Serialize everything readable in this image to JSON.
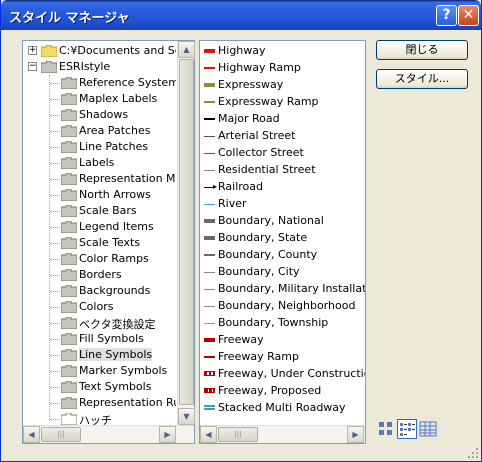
{
  "window": {
    "title": "スタイル マネージャ"
  },
  "titlebar_buttons": {
    "help": "?",
    "close": "✕"
  },
  "buttons": {
    "close_label": "閉じる",
    "styles_label": "スタイル..."
  },
  "tree": {
    "root1": "C:¥Documents and Setti",
    "root2": "ESRIstyle",
    "items": [
      "Reference Systems",
      "Maplex Labels",
      "Shadows",
      "Area Patches",
      "Line Patches",
      "Labels",
      "Representation Mark",
      "North Arrows",
      "Scale Bars",
      "Legend Items",
      "Scale Texts",
      "Color Ramps",
      "Borders",
      "Backgrounds",
      "Colors",
      "ベクタ変換設定",
      "Fill Symbols",
      "Line Symbols",
      "Marker Symbols",
      "Text Symbols",
      "Representation Rules",
      "ハッチ"
    ],
    "selected_index": 17
  },
  "symbols": [
    {
      "label": "Highway",
      "color": "#e01010",
      "style": "thick"
    },
    {
      "label": "Highway Ramp",
      "color": "#e01010",
      "style": "medium"
    },
    {
      "label": "Expressway",
      "color": "#8c8c3c",
      "style": "thick"
    },
    {
      "label": "Expressway Ramp",
      "color": "#8c8c3c",
      "style": "medium"
    },
    {
      "label": "Major Road",
      "color": "#000000",
      "style": "medium"
    },
    {
      "label": "Arterial Street",
      "color": "#555555",
      "style": "thin"
    },
    {
      "label": "Collector Street",
      "color": "#555555",
      "style": "thin"
    },
    {
      "label": "Residential Street",
      "color": "#888888",
      "style": "thin"
    },
    {
      "label": "Railroad",
      "color": "#000000",
      "style": "arrow"
    },
    {
      "label": "River",
      "color": "#4aa3e8",
      "style": "thin"
    },
    {
      "label": "Boundary, National",
      "color": "#6a6a6a",
      "style": "thick"
    },
    {
      "label": "Boundary, State",
      "color": "#6a6a6a",
      "style": "thick"
    },
    {
      "label": "Boundary, County",
      "color": "#6a6a6a",
      "style": "medium"
    },
    {
      "label": "Boundary, City",
      "color": "#8a8a8a",
      "style": "thin"
    },
    {
      "label": "Boundary, Military Installation",
      "color": "#8a8a8a",
      "style": "thin"
    },
    {
      "label": "Boundary, Neighborhood",
      "color": "#8a8a8a",
      "style": "thin"
    },
    {
      "label": "Boundary, Township",
      "color": "#d08080",
      "style": "thin"
    },
    {
      "label": "Freeway",
      "color": "#b00000",
      "style": "thick"
    },
    {
      "label": "Freeway Ramp",
      "color": "#b00000",
      "style": "medium"
    },
    {
      "label": "Freeway, Under Construction",
      "color": "#b00000",
      "style": "dashed"
    },
    {
      "label": "Freeway, Proposed",
      "color": "#b00000",
      "style": "dotted"
    },
    {
      "label": "Stacked Multi Roadway",
      "color": "#40a0a0",
      "style": "double"
    }
  ],
  "icons": {
    "folder": "folder-icon",
    "open_folder": "open-folder-icon",
    "view_large": "large-icons-view-icon",
    "view_list": "list-view-icon",
    "view_details": "details-view-icon"
  }
}
